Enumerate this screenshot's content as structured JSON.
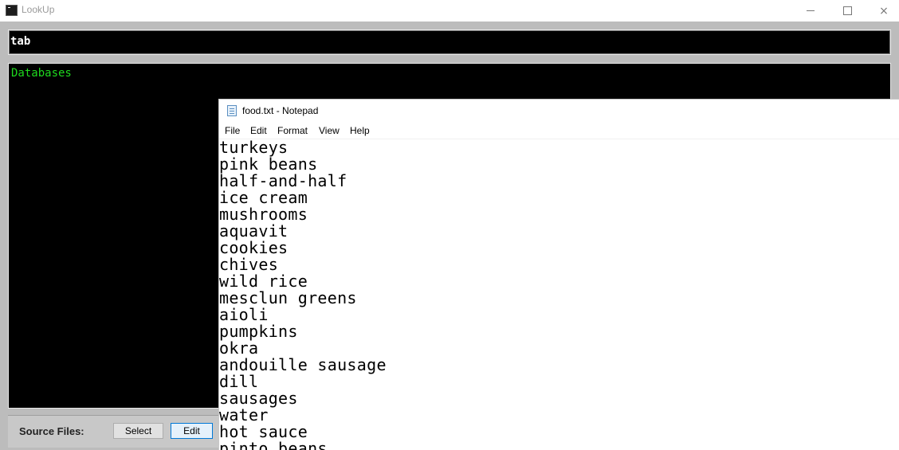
{
  "app": {
    "title": "LookUp"
  },
  "window_controls": {
    "minimize": "minimize",
    "maximize": "maximize",
    "close": "×"
  },
  "search": {
    "value": "tab"
  },
  "results": {
    "header": "Databases"
  },
  "source_files": {
    "label": "Source Files:",
    "select_label": "Select",
    "edit_label": "Edit"
  },
  "notepad": {
    "title": "food.txt - Notepad",
    "menu": [
      "File",
      "Edit",
      "Format",
      "View",
      "Help"
    ],
    "lines": [
      "turkeys",
      "pink beans",
      "half-and-half",
      "ice cream",
      "mushrooms",
      "aquavit",
      "cookies",
      "chives",
      "wild rice",
      "mesclun greens",
      "aioli",
      "pumpkins",
      "okra",
      "andouille sausage",
      "dill",
      "sausages",
      "water",
      "hot sauce",
      "pinto beans"
    ]
  },
  "colors": {
    "accent_green": "#1ed81e",
    "terminal_bg": "#000000",
    "window_bg": "#bcbcbc"
  }
}
